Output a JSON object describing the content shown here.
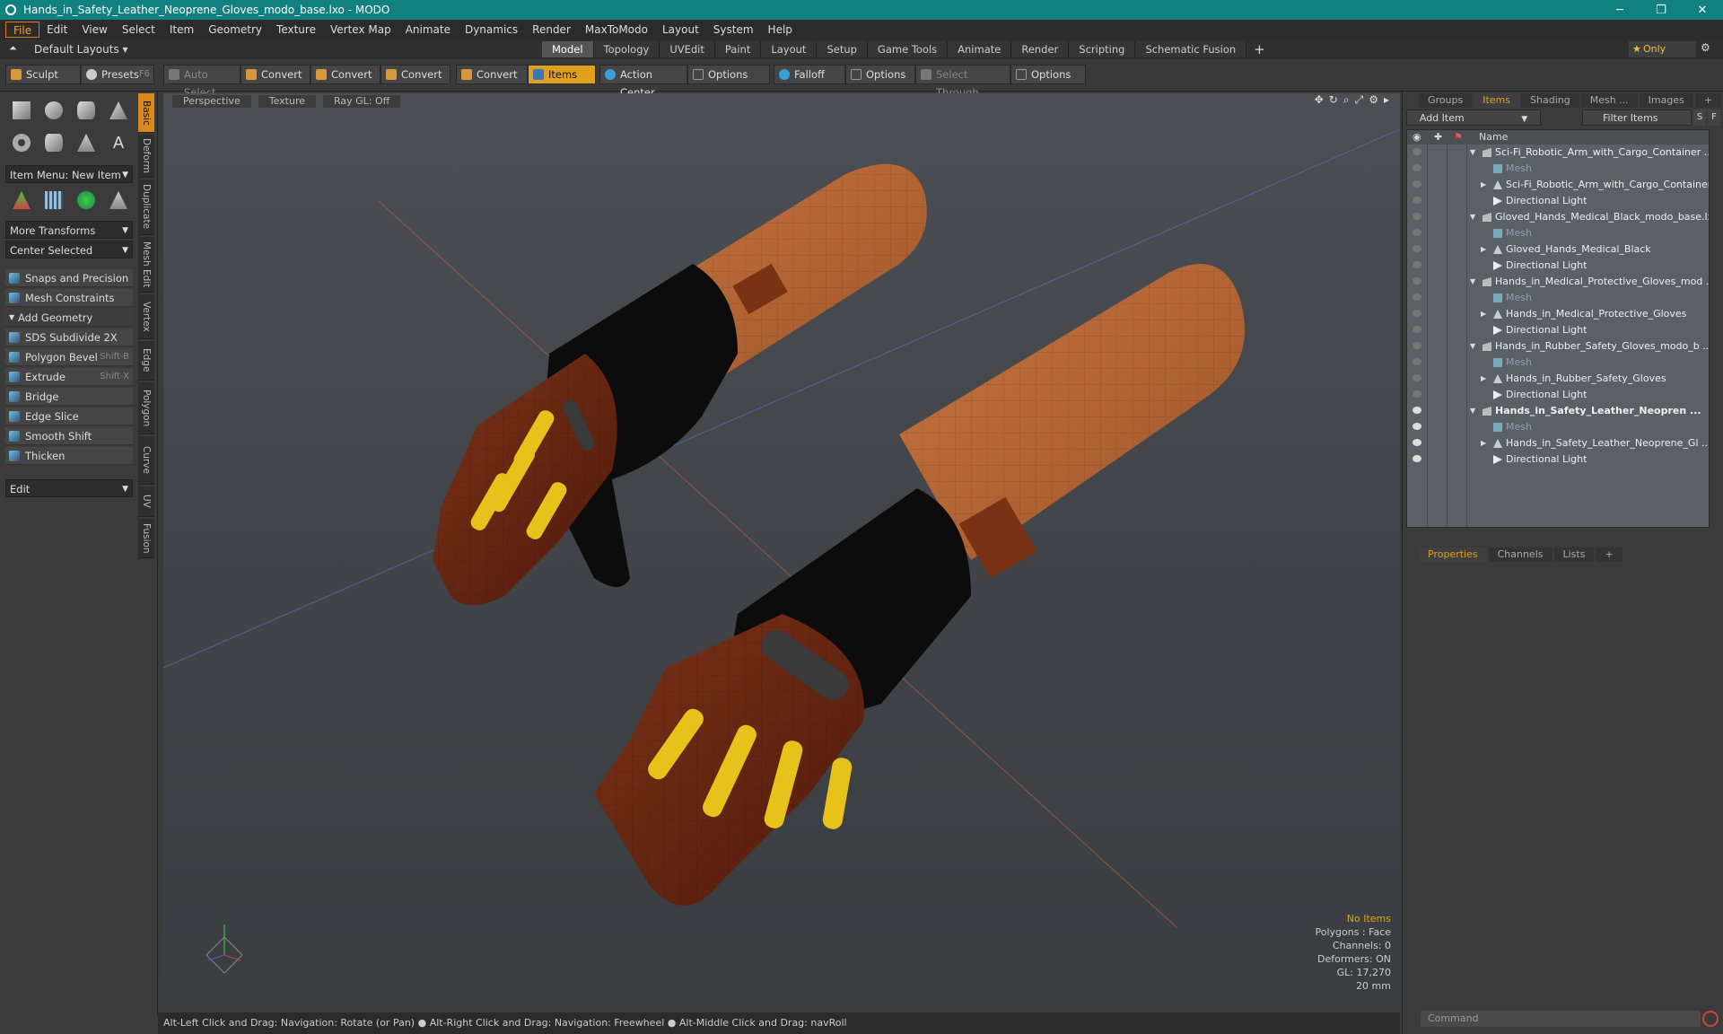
{
  "window": {
    "title": "Hands_in_Safety_Leather_Neoprene_Gloves_modo_base.lxo - MODO",
    "min": "─",
    "max": "❐",
    "close": "✕"
  },
  "menu": [
    "File",
    "Edit",
    "View",
    "Select",
    "Item",
    "Geometry",
    "Texture",
    "Vertex Map",
    "Animate",
    "Dynamics",
    "Render",
    "MaxToModo",
    "Layout",
    "System",
    "Help"
  ],
  "layout": {
    "default": "Default Layouts ▾",
    "tabs": [
      "Model",
      "Topology",
      "UVEdit",
      "Paint",
      "Layout",
      "Setup",
      "Game Tools",
      "Animate",
      "Render",
      "Scripting",
      "Schematic Fusion"
    ],
    "active": "Model",
    "plus": "+",
    "only": "Only"
  },
  "toolbar": {
    "sculpt": "Sculpt",
    "presets": "Presets",
    "presets_key": "F6",
    "auto_select": "Auto Select",
    "convert": "Convert",
    "items": "Items",
    "action_center": "Action Center",
    "options": "Options",
    "falloff": "Falloff",
    "select_through": "Select Through"
  },
  "left": {
    "item_menu": "Item Menu: New Item",
    "more_transforms": "More Transforms",
    "center_selected": "Center Selected",
    "snaps": "Snaps and Precision",
    "mesh_constraints": "Mesh Constraints",
    "add_geometry": "Add Geometry",
    "tools": [
      {
        "label": "SDS Subdivide 2X",
        "key": ""
      },
      {
        "label": "Polygon Bevel",
        "key": "Shift-B"
      },
      {
        "label": "Extrude",
        "key": "Shift-X"
      },
      {
        "label": "Bridge",
        "key": ""
      },
      {
        "label": "Edge Slice",
        "key": ""
      },
      {
        "label": "Smooth Shift",
        "key": ""
      },
      {
        "label": "Thicken",
        "key": ""
      }
    ],
    "edit": "Edit",
    "side_tabs": [
      "Basic",
      "Deform",
      "Duplicate",
      "Mesh Edit",
      "Vertex",
      "Edge",
      "Polygon",
      "Curve",
      "UV",
      "Fusion"
    ]
  },
  "viewport": {
    "tabs": [
      "Perspective",
      "Texture",
      "Ray GL: Off"
    ],
    "stats": [
      "No Items",
      "Polygons : Face",
      "Channels: 0",
      "Deformers: ON",
      "GL: 17,270",
      "20 mm"
    ]
  },
  "status": "Alt-Left Click and Drag: Navigation: Rotate (or Pan) ● Alt-Right Click and Drag: Navigation: Freewheel ● Alt-Middle Click and Drag: navRoll",
  "right": {
    "top_tabs": [
      "Groups",
      "Items",
      "Shading",
      "Mesh ...",
      "Images"
    ],
    "active_top": "Items",
    "add_item": "Add Item",
    "filter": "Filter Items",
    "s": "S",
    "f": "F",
    "name_header": "Name",
    "tree": [
      {
        "label": "Sci-Fi_Robotic_Arm_with_Cargo_Container ...",
        "type": "scene",
        "indent": 0,
        "eye": false,
        "bold": false,
        "dim": false,
        "expander": "▼"
      },
      {
        "label": "Mesh",
        "type": "mesh",
        "indent": 1,
        "eye": false,
        "bold": false,
        "dim": true,
        "expander": ""
      },
      {
        "label": "Sci-Fi_Robotic_Arm_with_Cargo_Container",
        "type": "loc",
        "indent": 1,
        "eye": false,
        "bold": false,
        "dim": false,
        "expander": "▶"
      },
      {
        "label": "Directional Light",
        "type": "light",
        "indent": 1,
        "eye": false,
        "bold": false,
        "dim": false,
        "expander": ""
      },
      {
        "label": "Gloved_Hands_Medical_Black_modo_base.lxo",
        "type": "scene",
        "indent": 0,
        "eye": false,
        "bold": false,
        "dim": false,
        "expander": "▼"
      },
      {
        "label": "Mesh",
        "type": "mesh",
        "indent": 1,
        "eye": false,
        "bold": false,
        "dim": true,
        "expander": ""
      },
      {
        "label": "Gloved_Hands_Medical_Black",
        "type": "loc",
        "indent": 1,
        "eye": false,
        "bold": false,
        "dim": false,
        "expander": "▶"
      },
      {
        "label": "Directional Light",
        "type": "light",
        "indent": 1,
        "eye": false,
        "bold": false,
        "dim": false,
        "expander": ""
      },
      {
        "label": "Hands_in_Medical_Protective_Gloves_mod ...",
        "type": "scene",
        "indent": 0,
        "eye": false,
        "bold": false,
        "dim": false,
        "expander": "▼"
      },
      {
        "label": "Mesh",
        "type": "mesh",
        "indent": 1,
        "eye": false,
        "bold": false,
        "dim": true,
        "expander": ""
      },
      {
        "label": "Hands_in_Medical_Protective_Gloves",
        "type": "loc",
        "indent": 1,
        "eye": false,
        "bold": false,
        "dim": false,
        "expander": "▶"
      },
      {
        "label": "Directional Light",
        "type": "light",
        "indent": 1,
        "eye": false,
        "bold": false,
        "dim": false,
        "expander": ""
      },
      {
        "label": "Hands_in_Rubber_Safety_Gloves_modo_b ...",
        "type": "scene",
        "indent": 0,
        "eye": false,
        "bold": false,
        "dim": false,
        "expander": "▼"
      },
      {
        "label": "Mesh",
        "type": "mesh",
        "indent": 1,
        "eye": false,
        "bold": false,
        "dim": true,
        "expander": ""
      },
      {
        "label": "Hands_in_Rubber_Safety_Gloves",
        "type": "loc",
        "indent": 1,
        "eye": false,
        "bold": false,
        "dim": false,
        "expander": "▶"
      },
      {
        "label": "Directional Light",
        "type": "light",
        "indent": 1,
        "eye": false,
        "bold": false,
        "dim": false,
        "expander": ""
      },
      {
        "label": "Hands_in_Safety_Leather_Neopren ...",
        "type": "scene",
        "indent": 0,
        "eye": true,
        "bold": true,
        "dim": false,
        "expander": "▼"
      },
      {
        "label": "Mesh",
        "type": "mesh",
        "indent": 1,
        "eye": true,
        "bold": false,
        "dim": true,
        "expander": ""
      },
      {
        "label": "Hands_in_Safety_Leather_Neoprene_Gl ...",
        "type": "loc",
        "indent": 1,
        "eye": true,
        "bold": false,
        "dim": false,
        "expander": "▶"
      },
      {
        "label": "Directional Light",
        "type": "light",
        "indent": 1,
        "eye": true,
        "bold": false,
        "dim": false,
        "expander": ""
      }
    ],
    "bottom_tabs": [
      "Properties",
      "Channels",
      "Lists"
    ],
    "active_bottom": "Properties",
    "command": "Command"
  }
}
